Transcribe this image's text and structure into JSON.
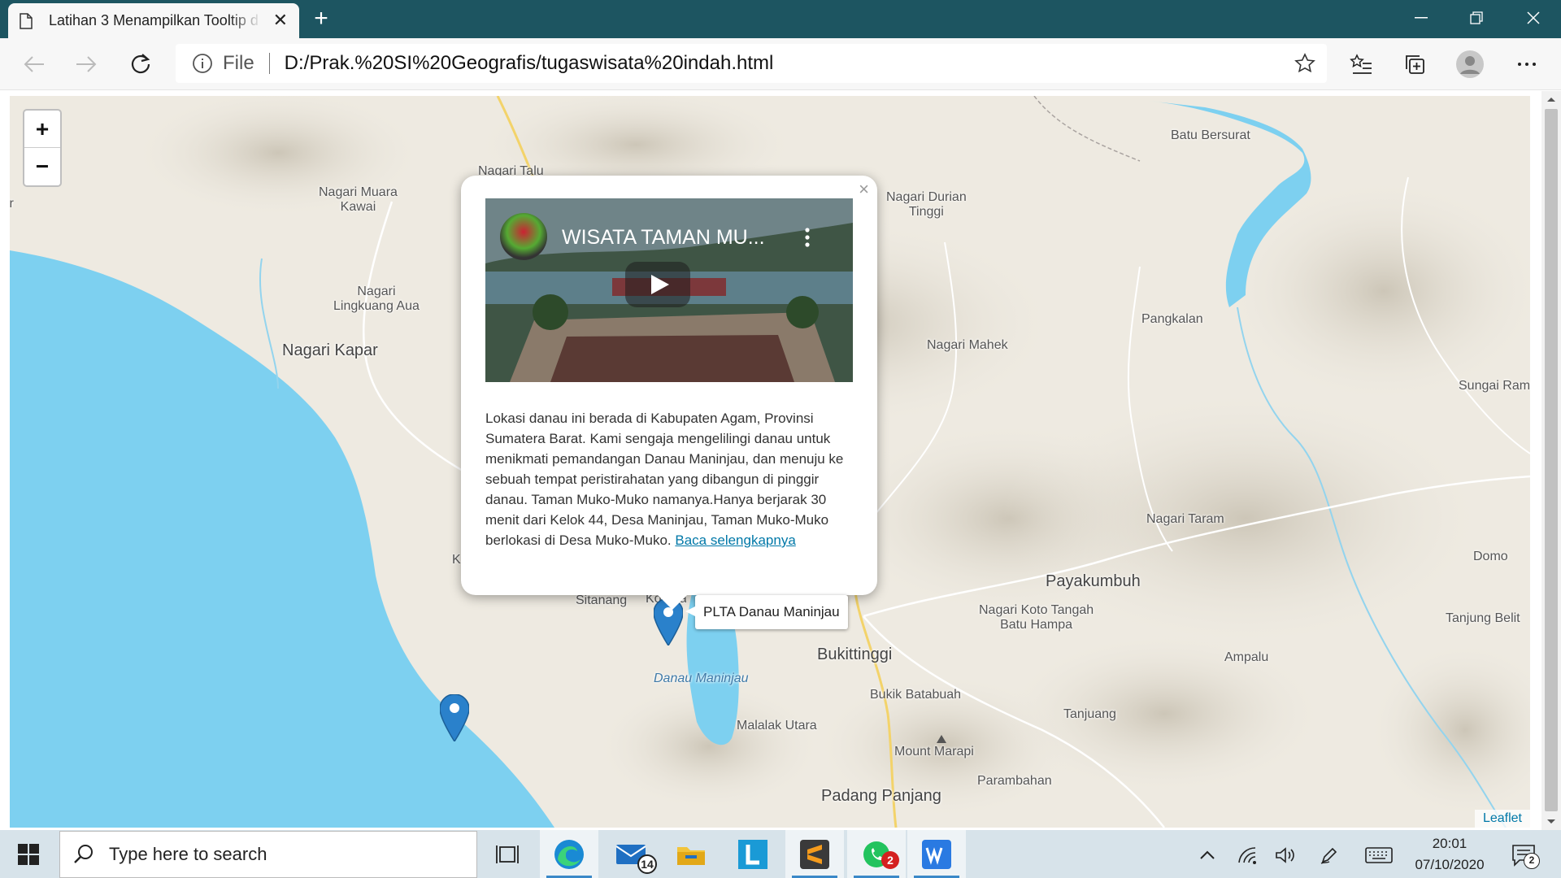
{
  "browser": {
    "tab_title": "Latihan 3 Menampilkan Tooltip d",
    "tab_close": "✕",
    "new_tab": "+",
    "address": {
      "scheme_label": "File",
      "url": "D:/Prak.%20SI%20Geografis/tugaswisata%20indah.html"
    }
  },
  "map": {
    "zoom_in": "+",
    "zoom_out": "−",
    "edge_label_left": "ir",
    "labels": [
      {
        "text": "Nagari Talu",
        "type": "town"
      },
      {
        "text": "Nagari Muara\nKawai",
        "type": "town"
      },
      {
        "text": "Nagari Durian\nTinggi",
        "type": "town"
      },
      {
        "text": "Batu Bersurat",
        "type": "town"
      },
      {
        "text": "Nagari\nLingkuang Aua",
        "type": "town"
      },
      {
        "text": "Pangkalan",
        "type": "town"
      },
      {
        "text": "Nagari Kapar",
        "type": "city"
      },
      {
        "text": "Nagari Mahek",
        "type": "town"
      },
      {
        "text": "Sungai Rami",
        "type": "town"
      },
      {
        "text": "Nagari Taram",
        "type": "town"
      },
      {
        "text": "Domo",
        "type": "town"
      },
      {
        "text": "Payakumbuh",
        "type": "city"
      },
      {
        "text": "Nagari Koto Tangah\nBatu Hampa",
        "type": "town"
      },
      {
        "text": "Tanjung Belit",
        "type": "town"
      },
      {
        "text": "Sitanang",
        "type": "town"
      },
      {
        "text": "Bukittinggi",
        "type": "city"
      },
      {
        "text": "Ampalu",
        "type": "town"
      },
      {
        "text": "Danau Maninjau",
        "type": "water"
      },
      {
        "text": "Bukik Batabuah",
        "type": "town"
      },
      {
        "text": "Tanjuang",
        "type": "town"
      },
      {
        "text": "Malalak Utara",
        "type": "town"
      },
      {
        "text": "Mount Marapi",
        "type": "town"
      },
      {
        "text": "Parambahan",
        "type": "town"
      },
      {
        "text": "Padang Panjang",
        "type": "city"
      },
      {
        "text": "K",
        "type": "town"
      },
      {
        "text": "Kotobaru",
        "type": "town"
      }
    ],
    "popup": {
      "close": "×",
      "video_title": "WISATA TAMAN MU...",
      "description": "Lokasi danau ini berada di Kabupaten Agam, Provinsi Sumatera Barat. Kami sengaja mengelilingi danau untuk menikmati pemandangan Danau Maninjau, dan menuju ke sebuah tempat peristirahatan yang dibangun di pinggir danau. Taman Muko-Muko namanya.Hanya berjarak 30 menit dari Kelok 44, Desa Maninjau, Taman Muko-Muko berlokasi di Desa Muko-Muko.",
      "link_text": "Baca selengkapnya"
    },
    "tooltip": "PLTA Danau Maninjau",
    "attribution": "Leaflet",
    "colors": {
      "water": "#7dd0f0",
      "land": "#eeeae1",
      "marker": "#2a81cb"
    }
  },
  "taskbar": {
    "search_placeholder": "Type here to search",
    "mail_badge": "14",
    "whatsapp_badge": "2",
    "time": "20:01",
    "date": "07/10/2020",
    "notification_count": "2"
  }
}
